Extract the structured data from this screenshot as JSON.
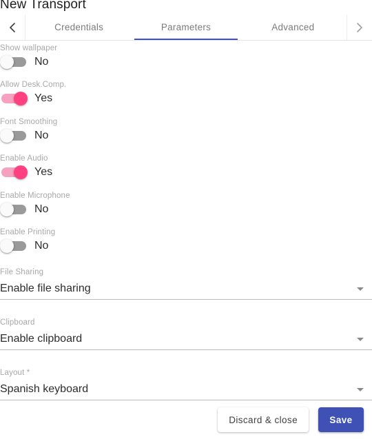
{
  "dialog": {
    "title": "New Transport"
  },
  "tabbar": {
    "prev_icon": "chevron-left-icon",
    "next_icon": "chevron-right-icon",
    "tabs": [
      {
        "label": "Credentials",
        "active": false
      },
      {
        "label": "Parameters",
        "active": true
      },
      {
        "label": "Advanced",
        "active": false
      }
    ],
    "active_indicator_color": "#3f51b5"
  },
  "colors": {
    "accent": "#3f51b5",
    "toggle_on": "#ff4081",
    "toggle_on_track": "#f8a0c0",
    "toggle_off_track": "#9a9a9a",
    "label_grey": "#a8a8a8"
  },
  "parameters": {
    "toggles": [
      {
        "label": "Show wallpaper",
        "value": "No",
        "on": false
      },
      {
        "label": "Allow Desk.Comp.",
        "value": "Yes",
        "on": true
      },
      {
        "label": "Font Smoothing",
        "value": "No",
        "on": false
      },
      {
        "label": "Enable Audio",
        "value": "Yes",
        "on": true
      },
      {
        "label": "Enable Microphone",
        "value": "No",
        "on": false
      },
      {
        "label": "Enable Printing",
        "value": "No",
        "on": false
      }
    ],
    "selects": [
      {
        "label": "File Sharing",
        "value": "Enable file sharing",
        "arrow_icon": "dropdown-arrow-icon"
      },
      {
        "label": "Clipboard",
        "value": "Enable clipboard",
        "arrow_icon": "dropdown-arrow-icon"
      },
      {
        "label": "Layout *",
        "value": "Spanish keyboard",
        "arrow_icon": "dropdown-arrow-icon"
      }
    ]
  },
  "footer": {
    "discard_label": "Discard & close",
    "save_label": "Save"
  }
}
